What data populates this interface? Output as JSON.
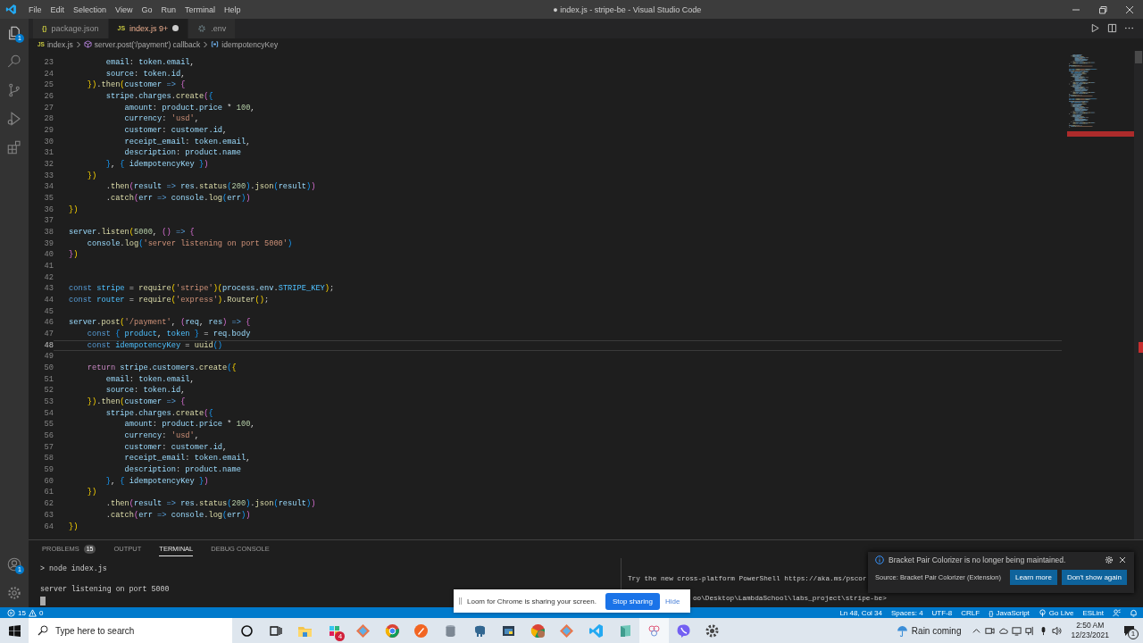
{
  "window": {
    "title": "● index.js - stripe-be - Visual Studio Code",
    "menu": [
      "File",
      "Edit",
      "Selection",
      "View",
      "Go",
      "Run",
      "Terminal",
      "Help"
    ]
  },
  "activity_bar": {
    "explorer_badge": "1",
    "accounts_badge": "1"
  },
  "tabs": [
    {
      "icon": "{}",
      "label": "package.json",
      "kind": "json",
      "selected": false,
      "modified": false
    },
    {
      "icon": "JS",
      "label": "index.js",
      "problems": "9+",
      "kind": "js",
      "selected": true,
      "modified": true
    },
    {
      "label": ".env",
      "kind": "settings",
      "selected": false,
      "modified": false
    }
  ],
  "breadcrumbs": [
    {
      "icon": "JS",
      "label": "index.js",
      "kind": "file"
    },
    {
      "label": "server.post('/payment') callback",
      "kind": "function"
    },
    {
      "label": "idempotencyKey",
      "kind": "variable"
    }
  ],
  "editor": {
    "lines": [
      {
        "number": "23",
        "current": false,
        "tokens": [
          {
            "kind": "var",
            "text": "        email"
          },
          {
            "kind": "txt",
            "text": ": "
          },
          {
            "kind": "var",
            "text": "token.email"
          },
          {
            "kind": "txt",
            "text": ","
          }
        ]
      },
      {
        "number": "24",
        "current": false,
        "tokens": [
          {
            "kind": "var",
            "text": "        source"
          },
          {
            "kind": "txt",
            "text": ": "
          },
          {
            "kind": "var",
            "text": "token.id"
          },
          {
            "kind": "txt",
            "text": ","
          }
        ]
      },
      {
        "number": "25",
        "current": false,
        "tokens": [
          {
            "kind": "b1",
            "text": "    })"
          },
          {
            "kind": "txt",
            "text": "."
          },
          {
            "kind": "fn",
            "text": "then"
          },
          {
            "kind": "b1",
            "text": "("
          },
          {
            "kind": "var",
            "text": "customer"
          },
          {
            "kind": "kw",
            "text": " =>"
          },
          {
            "kind": "b2",
            "text": " {"
          }
        ]
      },
      {
        "number": "26",
        "current": false,
        "tokens": [
          {
            "kind": "var",
            "text": "        stripe"
          },
          {
            "kind": "txt",
            "text": "."
          },
          {
            "kind": "var",
            "text": "charges"
          },
          {
            "kind": "txt",
            "text": "."
          },
          {
            "kind": "fn",
            "text": "create"
          },
          {
            "kind": "b2",
            "text": "("
          },
          {
            "kind": "b3",
            "text": "{"
          }
        ]
      },
      {
        "number": "27",
        "current": false,
        "tokens": [
          {
            "kind": "var",
            "text": "            amount"
          },
          {
            "kind": "txt",
            "text": ": "
          },
          {
            "kind": "var",
            "text": "product.price"
          },
          {
            "kind": "txt",
            "text": " * "
          },
          {
            "kind": "num",
            "text": "100"
          },
          {
            "kind": "txt",
            "text": ","
          }
        ]
      },
      {
        "number": "28",
        "current": false,
        "tokens": [
          {
            "kind": "var",
            "text": "            currency"
          },
          {
            "kind": "txt",
            "text": ": "
          },
          {
            "kind": "str",
            "text": "'usd'"
          },
          {
            "kind": "txt",
            "text": ","
          }
        ]
      },
      {
        "number": "29",
        "current": false,
        "tokens": [
          {
            "kind": "var",
            "text": "            customer"
          },
          {
            "kind": "txt",
            "text": ": "
          },
          {
            "kind": "var",
            "text": "customer.id"
          },
          {
            "kind": "txt",
            "text": ","
          }
        ]
      },
      {
        "number": "30",
        "current": false,
        "tokens": [
          {
            "kind": "var",
            "text": "            receipt_email"
          },
          {
            "kind": "txt",
            "text": ": "
          },
          {
            "kind": "var",
            "text": "token.email"
          },
          {
            "kind": "txt",
            "text": ","
          }
        ]
      },
      {
        "number": "31",
        "current": false,
        "tokens": [
          {
            "kind": "var",
            "text": "            description"
          },
          {
            "kind": "txt",
            "text": ": "
          },
          {
            "kind": "var",
            "text": "product.name"
          }
        ]
      },
      {
        "number": "32",
        "current": false,
        "tokens": [
          {
            "kind": "b3",
            "text": "        }"
          },
          {
            "kind": "txt",
            "text": ", "
          },
          {
            "kind": "b3",
            "text": "{"
          },
          {
            "kind": "var",
            "text": " idempotencyKey "
          },
          {
            "kind": "b3",
            "text": "}"
          },
          {
            "kind": "b2",
            "text": ")"
          }
        ]
      },
      {
        "number": "33",
        "current": false,
        "tokens": [
          {
            "kind": "b1",
            "text": "    })"
          }
        ]
      },
      {
        "number": "34",
        "current": false,
        "tokens": [
          {
            "kind": "txt",
            "text": "        ."
          },
          {
            "kind": "fn",
            "text": "then"
          },
          {
            "kind": "b2",
            "text": "("
          },
          {
            "kind": "var",
            "text": "result"
          },
          {
            "kind": "kw",
            "text": " => "
          },
          {
            "kind": "var",
            "text": "res"
          },
          {
            "kind": "txt",
            "text": "."
          },
          {
            "kind": "fn",
            "text": "status"
          },
          {
            "kind": "b3",
            "text": "("
          },
          {
            "kind": "num",
            "text": "200"
          },
          {
            "kind": "b3",
            "text": ")"
          },
          {
            "kind": "txt",
            "text": "."
          },
          {
            "kind": "fn",
            "text": "json"
          },
          {
            "kind": "b3",
            "text": "("
          },
          {
            "kind": "var",
            "text": "result"
          },
          {
            "kind": "b3",
            "text": ")"
          },
          {
            "kind": "b2",
            "text": ")"
          }
        ]
      },
      {
        "number": "35",
        "current": false,
        "tokens": [
          {
            "kind": "txt",
            "text": "        ."
          },
          {
            "kind": "fn",
            "text": "catch"
          },
          {
            "kind": "b2",
            "text": "("
          },
          {
            "kind": "var",
            "text": "err"
          },
          {
            "kind": "kw",
            "text": " => "
          },
          {
            "kind": "var",
            "text": "console"
          },
          {
            "kind": "txt",
            "text": "."
          },
          {
            "kind": "fn",
            "text": "log"
          },
          {
            "kind": "b3",
            "text": "("
          },
          {
            "kind": "var",
            "text": "err"
          },
          {
            "kind": "b3",
            "text": ")"
          },
          {
            "kind": "b2",
            "text": ")"
          }
        ]
      },
      {
        "number": "36",
        "current": false,
        "tokens": [
          {
            "kind": "b1",
            "text": "})"
          }
        ]
      },
      {
        "number": "37",
        "current": false
      },
      {
        "number": "38",
        "current": false,
        "tokens": [
          {
            "kind": "var",
            "text": "server"
          },
          {
            "kind": "txt",
            "text": "."
          },
          {
            "kind": "fn",
            "text": "listen"
          },
          {
            "kind": "b1",
            "text": "("
          },
          {
            "kind": "num",
            "text": "5000"
          },
          {
            "kind": "txt",
            "text": ", "
          },
          {
            "kind": "b2",
            "text": "()"
          },
          {
            "kind": "kw",
            "text": " =>"
          },
          {
            "kind": "b2",
            "text": " {"
          }
        ]
      },
      {
        "number": "39",
        "current": false,
        "tokens": [
          {
            "kind": "var",
            "text": "    console"
          },
          {
            "kind": "txt",
            "text": "."
          },
          {
            "kind": "fn",
            "text": "log"
          },
          {
            "kind": "b3",
            "text": "("
          },
          {
            "kind": "str",
            "text": "'server listening on port 5000'"
          },
          {
            "kind": "b3",
            "text": ")"
          }
        ]
      },
      {
        "number": "40",
        "current": false,
        "tokens": [
          {
            "kind": "b2",
            "text": "}"
          },
          {
            "kind": "b1",
            "text": ")"
          }
        ]
      },
      {
        "number": "41",
        "current": false
      },
      {
        "number": "42",
        "current": false
      },
      {
        "number": "43",
        "current": false,
        "tokens": [
          {
            "kind": "kw",
            "text": "const"
          },
          {
            "kind": "con",
            "text": " stripe"
          },
          {
            "kind": "txt",
            "text": " = "
          },
          {
            "kind": "fn",
            "text": "require"
          },
          {
            "kind": "b1",
            "text": "("
          },
          {
            "kind": "str",
            "text": "'stripe'"
          },
          {
            "kind": "b1",
            "text": ")("
          },
          {
            "kind": "var",
            "text": "process.env"
          },
          {
            "kind": "txt",
            "text": "."
          },
          {
            "kind": "con",
            "text": "STRIPE_KEY"
          },
          {
            "kind": "b1",
            "text": ")"
          },
          {
            "kind": "txt",
            "text": ";"
          }
        ]
      },
      {
        "number": "44",
        "current": false,
        "tokens": [
          {
            "kind": "kw",
            "text": "const"
          },
          {
            "kind": "con",
            "text": " router"
          },
          {
            "kind": "txt",
            "text": " = "
          },
          {
            "kind": "fn",
            "text": "require"
          },
          {
            "kind": "b1",
            "text": "("
          },
          {
            "kind": "str",
            "text": "'express'"
          },
          {
            "kind": "b1",
            "text": ")"
          },
          {
            "kind": "txt",
            "text": "."
          },
          {
            "kind": "fn",
            "text": "Router"
          },
          {
            "kind": "b1",
            "text": "()"
          },
          {
            "kind": "txt",
            "text": ";"
          }
        ]
      },
      {
        "number": "45",
        "current": false
      },
      {
        "number": "46",
        "current": false,
        "tokens": [
          {
            "kind": "var",
            "text": "server"
          },
          {
            "kind": "txt",
            "text": "."
          },
          {
            "kind": "fn",
            "text": "post"
          },
          {
            "kind": "b1",
            "text": "("
          },
          {
            "kind": "str",
            "text": "'/payment'"
          },
          {
            "kind": "txt",
            "text": ", "
          },
          {
            "kind": "b2",
            "text": "("
          },
          {
            "kind": "var",
            "text": "req"
          },
          {
            "kind": "txt",
            "text": ", "
          },
          {
            "kind": "var",
            "text": "res"
          },
          {
            "kind": "b2",
            "text": ")"
          },
          {
            "kind": "kw",
            "text": " =>"
          },
          {
            "kind": "b2",
            "text": " {"
          }
        ]
      },
      {
        "number": "47",
        "current": false,
        "tokens": [
          {
            "kind": "kw",
            "text": "    const"
          },
          {
            "kind": "b3",
            "text": " {"
          },
          {
            "kind": "con",
            "text": " product"
          },
          {
            "kind": "txt",
            "text": ", "
          },
          {
            "kind": "con",
            "text": "token"
          },
          {
            "kind": "b3",
            "text": " }"
          },
          {
            "kind": "txt",
            "text": " = "
          },
          {
            "kind": "var",
            "text": "req.body"
          }
        ]
      },
      {
        "number": "48",
        "current": true,
        "tokens": [
          {
            "kind": "kw",
            "text": "    const"
          },
          {
            "kind": "con",
            "text": " idempotencyKey"
          },
          {
            "kind": "txt",
            "text": " = "
          },
          {
            "kind": "fn",
            "text": "uuid"
          },
          {
            "kind": "b3",
            "text": "()"
          }
        ]
      },
      {
        "number": "49",
        "current": false
      },
      {
        "number": "50",
        "current": false,
        "tokens": [
          {
            "kind": "ctl",
            "text": "    return"
          },
          {
            "kind": "var",
            "text": " stripe"
          },
          {
            "kind": "txt",
            "text": "."
          },
          {
            "kind": "var",
            "text": "customers"
          },
          {
            "kind": "txt",
            "text": "."
          },
          {
            "kind": "fn",
            "text": "create"
          },
          {
            "kind": "b3",
            "text": "("
          },
          {
            "kind": "b1",
            "text": "{"
          }
        ]
      },
      {
        "number": "51",
        "current": false,
        "tokens": [
          {
            "kind": "var",
            "text": "        email"
          },
          {
            "kind": "txt",
            "text": ": "
          },
          {
            "kind": "var",
            "text": "token.email"
          },
          {
            "kind": "txt",
            "text": ","
          }
        ]
      },
      {
        "number": "52",
        "current": false,
        "tokens": [
          {
            "kind": "var",
            "text": "        source"
          },
          {
            "kind": "txt",
            "text": ": "
          },
          {
            "kind": "var",
            "text": "token.id"
          },
          {
            "kind": "txt",
            "text": ","
          }
        ]
      },
      {
        "number": "53",
        "current": false,
        "tokens": [
          {
            "kind": "b1",
            "text": "    })"
          },
          {
            "kind": "txt",
            "text": "."
          },
          {
            "kind": "fn",
            "text": "then"
          },
          {
            "kind": "b1",
            "text": "("
          },
          {
            "kind": "var",
            "text": "customer"
          },
          {
            "kind": "kw",
            "text": " =>"
          },
          {
            "kind": "b2",
            "text": " {"
          }
        ]
      },
      {
        "number": "54",
        "current": false,
        "tokens": [
          {
            "kind": "var",
            "text": "        stripe"
          },
          {
            "kind": "txt",
            "text": "."
          },
          {
            "kind": "var",
            "text": "charges"
          },
          {
            "kind": "txt",
            "text": "."
          },
          {
            "kind": "fn",
            "text": "create"
          },
          {
            "kind": "b2",
            "text": "("
          },
          {
            "kind": "b3",
            "text": "{"
          }
        ]
      },
      {
        "number": "55",
        "current": false,
        "tokens": [
          {
            "kind": "var",
            "text": "            amount"
          },
          {
            "kind": "txt",
            "text": ": "
          },
          {
            "kind": "var",
            "text": "product.price"
          },
          {
            "kind": "txt",
            "text": " * "
          },
          {
            "kind": "num",
            "text": "100"
          },
          {
            "kind": "txt",
            "text": ","
          }
        ]
      },
      {
        "number": "56",
        "current": false,
        "tokens": [
          {
            "kind": "var",
            "text": "            currency"
          },
          {
            "kind": "txt",
            "text": ": "
          },
          {
            "kind": "str",
            "text": "'usd'"
          },
          {
            "kind": "txt",
            "text": ","
          }
        ]
      },
      {
        "number": "57",
        "current": false,
        "tokens": [
          {
            "kind": "var",
            "text": "            customer"
          },
          {
            "kind": "txt",
            "text": ": "
          },
          {
            "kind": "var",
            "text": "customer.id"
          },
          {
            "kind": "txt",
            "text": ","
          }
        ]
      },
      {
        "number": "58",
        "current": false,
        "tokens": [
          {
            "kind": "var",
            "text": "            receipt_email"
          },
          {
            "kind": "txt",
            "text": ": "
          },
          {
            "kind": "var",
            "text": "token.email"
          },
          {
            "kind": "txt",
            "text": ","
          }
        ]
      },
      {
        "number": "59",
        "current": false,
        "tokens": [
          {
            "kind": "var",
            "text": "            description"
          },
          {
            "kind": "txt",
            "text": ": "
          },
          {
            "kind": "var",
            "text": "product.name"
          }
        ]
      },
      {
        "number": "60",
        "current": false,
        "tokens": [
          {
            "kind": "b3",
            "text": "        }"
          },
          {
            "kind": "txt",
            "text": ", "
          },
          {
            "kind": "b3",
            "text": "{"
          },
          {
            "kind": "var",
            "text": " idempotencyKey "
          },
          {
            "kind": "b3",
            "text": "}"
          },
          {
            "kind": "b2",
            "text": ")"
          }
        ]
      },
      {
        "number": "61",
        "current": false,
        "tokens": [
          {
            "kind": "b1",
            "text": "    })"
          }
        ]
      },
      {
        "number": "62",
        "current": false,
        "tokens": [
          {
            "kind": "txt",
            "text": "        ."
          },
          {
            "kind": "fn",
            "text": "then"
          },
          {
            "kind": "b2",
            "text": "("
          },
          {
            "kind": "var",
            "text": "result"
          },
          {
            "kind": "kw",
            "text": " => "
          },
          {
            "kind": "var",
            "text": "res"
          },
          {
            "kind": "txt",
            "text": "."
          },
          {
            "kind": "fn",
            "text": "status"
          },
          {
            "kind": "b3",
            "text": "("
          },
          {
            "kind": "num",
            "text": "200"
          },
          {
            "kind": "b3",
            "text": ")"
          },
          {
            "kind": "txt",
            "text": "."
          },
          {
            "kind": "fn",
            "text": "json"
          },
          {
            "kind": "b3",
            "text": "("
          },
          {
            "kind": "var",
            "text": "result"
          },
          {
            "kind": "b3",
            "text": ")"
          },
          {
            "kind": "b2",
            "text": ")"
          }
        ]
      },
      {
        "number": "63",
        "current": false,
        "tokens": [
          {
            "kind": "txt",
            "text": "        ."
          },
          {
            "kind": "fn",
            "text": "catch"
          },
          {
            "kind": "b2",
            "text": "("
          },
          {
            "kind": "var",
            "text": "err"
          },
          {
            "kind": "kw",
            "text": " => "
          },
          {
            "kind": "var",
            "text": "console"
          },
          {
            "kind": "txt",
            "text": "."
          },
          {
            "kind": "fn",
            "text": "log"
          },
          {
            "kind": "b3",
            "text": "("
          },
          {
            "kind": "var",
            "text": "err"
          },
          {
            "kind": "b3",
            "text": ")"
          },
          {
            "kind": "b2",
            "text": ")"
          }
        ]
      },
      {
        "number": "64",
        "current": false,
        "tokens": [
          {
            "kind": "b1",
            "text": "})"
          }
        ]
      }
    ]
  },
  "panel": {
    "tabs": [
      {
        "label": "PROBLEMS",
        "count": "15",
        "selected": false
      },
      {
        "label": "OUTPUT",
        "selected": false
      },
      {
        "label": "TERMINAL",
        "selected": true
      },
      {
        "label": "DEBUG CONSOLE",
        "selected": false
      }
    ],
    "terminal": {
      "command": "> node index.js",
      "output": "server listening on port 5000"
    },
    "terminal_2": {
      "lines": [
        "Try the new cross-platform PowerShell https://aka.ms/pscor",
        "oo\\Desktop\\LambdaSchool\\labs_project\\stripe-be>"
      ]
    }
  },
  "notification": {
    "message": "Bracket Pair Colorizer is no longer being maintained.",
    "source": "Source: Bracket Pair Colorizer (Extension)",
    "buttons": [
      "Learn more",
      "Don't show again"
    ]
  },
  "screen_share": {
    "message": "Loom for Chrome is sharing your screen.",
    "stop": "Stop sharing",
    "hide": "Hide"
  },
  "status_bar": {
    "errors": "15",
    "warnings": "0",
    "items": [
      {
        "label": "Ln 48, Col 34",
        "kind": "text"
      },
      {
        "label": "Spaces: 4",
        "kind": "text"
      },
      {
        "label": "UTF-8",
        "kind": "text"
      },
      {
        "label": "CRLF",
        "kind": "text"
      },
      {
        "icon": "{}",
        "label": "JavaScript",
        "kind": "language"
      },
      {
        "label": "Go Live",
        "kind": "live"
      },
      {
        "label": "ESLint",
        "kind": "text"
      }
    ]
  },
  "taskbar": {
    "search_placeholder": "Type here to search",
    "app_badge": "4",
    "weather": "Rain coming",
    "time": "2:50 AM",
    "date": "12/23/2021",
    "notification_count": "1"
  }
}
